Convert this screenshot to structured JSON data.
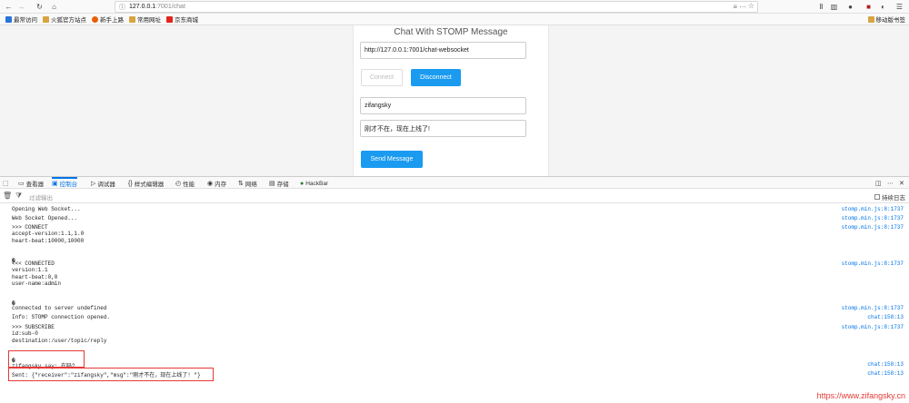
{
  "browser": {
    "url_host": "127.0.0.1",
    "url_path": ":7001/chat",
    "bookmarks": [
      {
        "label": "最常访问",
        "color": "#2a74d9"
      },
      {
        "label": "火狐官方站点",
        "color": "#3d8bea"
      },
      {
        "label": "新手上路",
        "color": "#e66000"
      },
      {
        "label": "常用网址",
        "color": "#3d8bea"
      },
      {
        "label": "京东商城",
        "color": "#e1251b"
      }
    ],
    "mobile_bookmarks": "移动版书签"
  },
  "page": {
    "title": "Chat With STOMP Message",
    "url_value": "http://127.0.0.1:7001/chat-websocket",
    "connect_label": "Connect",
    "disconnect_label": "Disconnect",
    "receiver_value": "zifangsky",
    "message_value": "刚才不在，现在上线了!",
    "send_label": "Send Message"
  },
  "devtools": {
    "tabs": [
      {
        "icon": "inspector-icon",
        "label": "查看器"
      },
      {
        "icon": "console-icon",
        "label": "控制台"
      },
      {
        "icon": "debugger-icon",
        "label": "调试器"
      },
      {
        "icon": "style-editor-icon",
        "label": "样式编辑器"
      },
      {
        "icon": "performance-icon",
        "label": "性能"
      },
      {
        "icon": "memory-icon",
        "label": "内存"
      },
      {
        "icon": "network-icon",
        "label": "网络"
      },
      {
        "icon": "storage-icon",
        "label": "存储"
      },
      {
        "icon": "hackbar-icon",
        "label": "HackBar"
      }
    ],
    "filter_placeholder": "过滤输出",
    "persist_logs": "持续日志"
  },
  "console": {
    "entries": [
      {
        "lines": [
          "Opening Web Socket..."
        ],
        "source": "stomp.min.js:8:1737"
      },
      {
        "lines": [
          "Web Socket Opened..."
        ],
        "source": "stomp.min.js:8:1737"
      },
      {
        "lines": [
          ">>> CONNECT",
          "accept-version:1.1,1.0",
          "heart-beat:10000,10000",
          "",
          "",
          "�"
        ],
        "source": "stomp.min.js:8:1737"
      },
      {
        "lines": [
          "<<< CONNECTED",
          "version:1.1",
          "heart-beat:0,0",
          "user-name:admin",
          "",
          "",
          "�"
        ],
        "source": "stomp.min.js:8:1737"
      },
      {
        "lines": [
          "connected to server undefined"
        ],
        "source": "stomp.min.js:8:1737"
      },
      {
        "lines": [
          "Info: STOMP connection opened."
        ],
        "source": "chat:158:13"
      },
      {
        "lines": [
          ">>> SUBSCRIBE",
          "id:sub-0",
          "destination:/user/topic/reply",
          "",
          "",
          "�"
        ],
        "source": "stomp.min.js:8:1737"
      },
      {
        "lines": [
          "zifangsky say: 在吗?"
        ],
        "source": "chat:158:13"
      },
      {
        "lines": [
          "Sent: {\"receiver\":\"zifangsky\",\"msg\":\"刚才不在，现在上线了! \"}"
        ],
        "source": "chat:158:13"
      }
    ]
  },
  "watermark": "https://www.zifangsky.cn"
}
